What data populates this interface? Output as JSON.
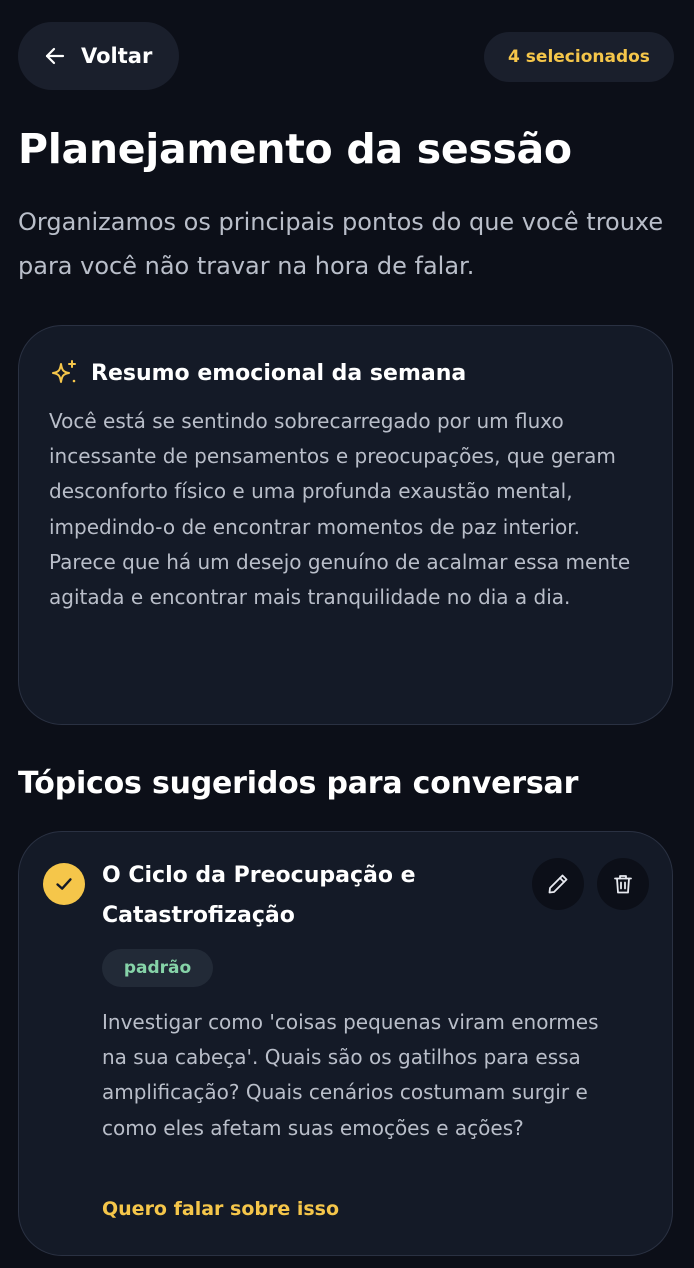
{
  "header": {
    "back_label": "Voltar",
    "selected_label": "4 selecionados"
  },
  "page": {
    "title": "Planejamento da sessão",
    "subtitle": "Organizamos os principais pontos do que você trouxe para você não travar na hora de falar."
  },
  "summary": {
    "icon": "sparkles-icon",
    "title": "Resumo emocional da semana",
    "text": "Você está se sentindo sobrecarregado por um fluxo incessante de pensamentos e preocupações, que geram desconforto físico e uma profunda exaustão mental, impedindo-o de encontrar momentos de paz interior. Parece que há um desejo genuíno de acalmar essa mente agitada e encontrar mais tranquilidade no dia a dia."
  },
  "topics": {
    "section_title": "Tópicos sugeridos para conversar",
    "items": [
      {
        "selected": true,
        "title": "O Ciclo da Preocupação e Catastrofização",
        "tag": "padrão",
        "description": "Investigar como 'coisas pequenas viram enormes na sua cabeça'. Quais são os gatilhos para essa amplificação? Quais cenários costumam surgir e como eles afetam suas emoções e ações?",
        "cta": "Quero falar sobre isso"
      }
    ]
  },
  "colors": {
    "background": "#0c0f18",
    "card": "#141a27",
    "accent": "#f5c64a",
    "tag_text": "#86d3a8",
    "muted_text": "#b9bec9"
  }
}
